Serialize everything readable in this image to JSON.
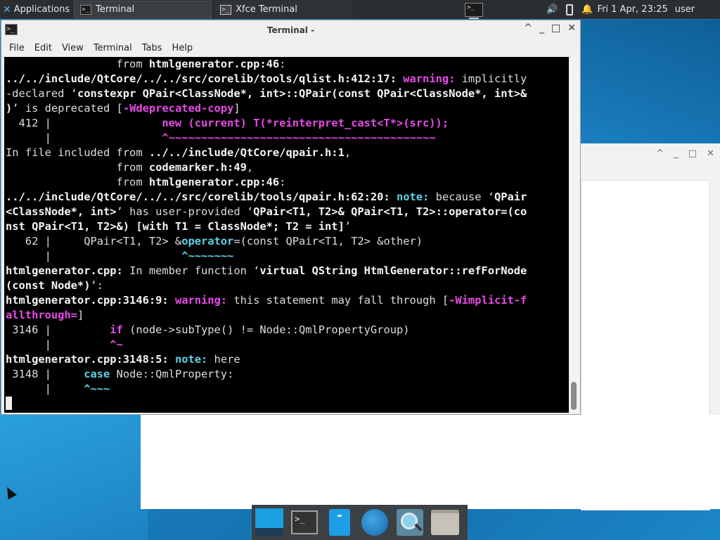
{
  "panel": {
    "applications_label": "Applications",
    "tasks": [
      "Terminal",
      "Xfce Terminal"
    ],
    "clock": "Fri  1 Apr, 23:25",
    "user": "user"
  },
  "terminal": {
    "title": "Terminal -",
    "menu": [
      "File",
      "Edit",
      "View",
      "Terminal",
      "Tabs",
      "Help"
    ]
  },
  "colors": {
    "desktop": "#1a7fc0",
    "panel": "#2b2e31",
    "terminal_bg": "#000000",
    "warning": "#e84be8",
    "note": "#5ed2e8"
  },
  "dock_items": [
    "show-desktop-icon",
    "terminal-icon",
    "file-manager-icon",
    "web-browser-icon",
    "app-finder-icon",
    "home-folder-icon"
  ]
}
